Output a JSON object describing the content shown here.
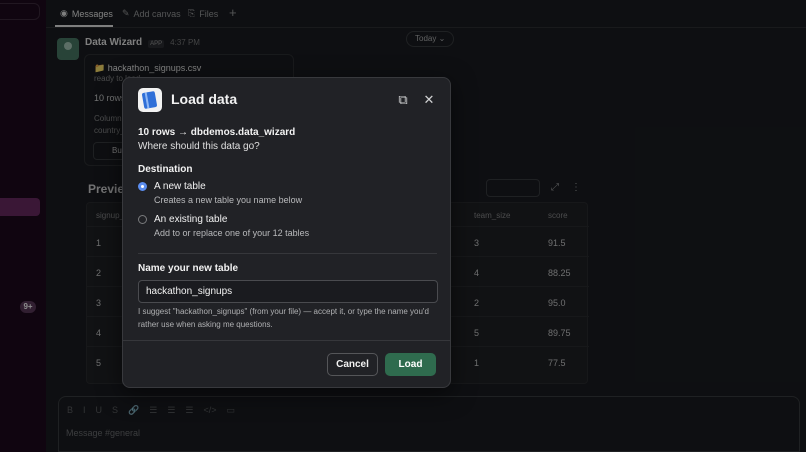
{
  "tabs": {
    "messages": "Messages",
    "add_canvas": "Add canvas",
    "files": "Files",
    "add": "+"
  },
  "sidebar": {
    "badge": "9+"
  },
  "message": {
    "sender": "Data Wizard",
    "app_tag": "APP",
    "time": "4:37 PM",
    "date_pill": "Today ⌄"
  },
  "file_card": {
    "icon": "📁",
    "file_name": "hackathon_signups.csv",
    "status": "ready to load",
    "rows": "10 rows",
    "columns_line1": "Columns",
    "columns_line2": "country_",
    "button": "Bu"
  },
  "preview": {
    "title": "Preview",
    "columns": [
      "signup_",
      "team_size",
      "score"
    ],
    "rows": [
      {
        "id": "1",
        "team_size": "3",
        "score": "91.5"
      },
      {
        "id": "2",
        "team_size": "4",
        "score": "88.25"
      },
      {
        "id": "3",
        "team_size": "2",
        "score": "95.0"
      },
      {
        "id": "4",
        "team_size": "5",
        "score": "89.75"
      },
      {
        "id": "5",
        "team_size": "1",
        "score": "77.5"
      }
    ]
  },
  "composer": {
    "placeholder": "Message #general",
    "tools": [
      "B",
      "I",
      "U",
      "S",
      "🔗",
      "☰",
      "☰",
      "☰",
      "</>",
      "▭"
    ]
  },
  "modal": {
    "title": "Load data",
    "summary": "10 rows → dbdemos.data_wizard",
    "question": "Where should this data go?",
    "destination_label": "Destination",
    "options": [
      {
        "title": "A new table",
        "desc": "Creates a new table you name below",
        "selected": true
      },
      {
        "title": "An existing table",
        "desc": "Add to or replace one of your 12 tables",
        "selected": false
      }
    ],
    "name_label": "Name your new table",
    "name_value": "hackathon_signups",
    "hint": "I suggest \"hackathon_signups\" (from your file) — accept it, or type the name you'd rather use when asking me questions.",
    "cancel": "Cancel",
    "load": "Load",
    "popout_icon": "⧉",
    "close_icon": "✕",
    "accent_color": "#2f6b4e",
    "radio_color": "#5b8def"
  }
}
